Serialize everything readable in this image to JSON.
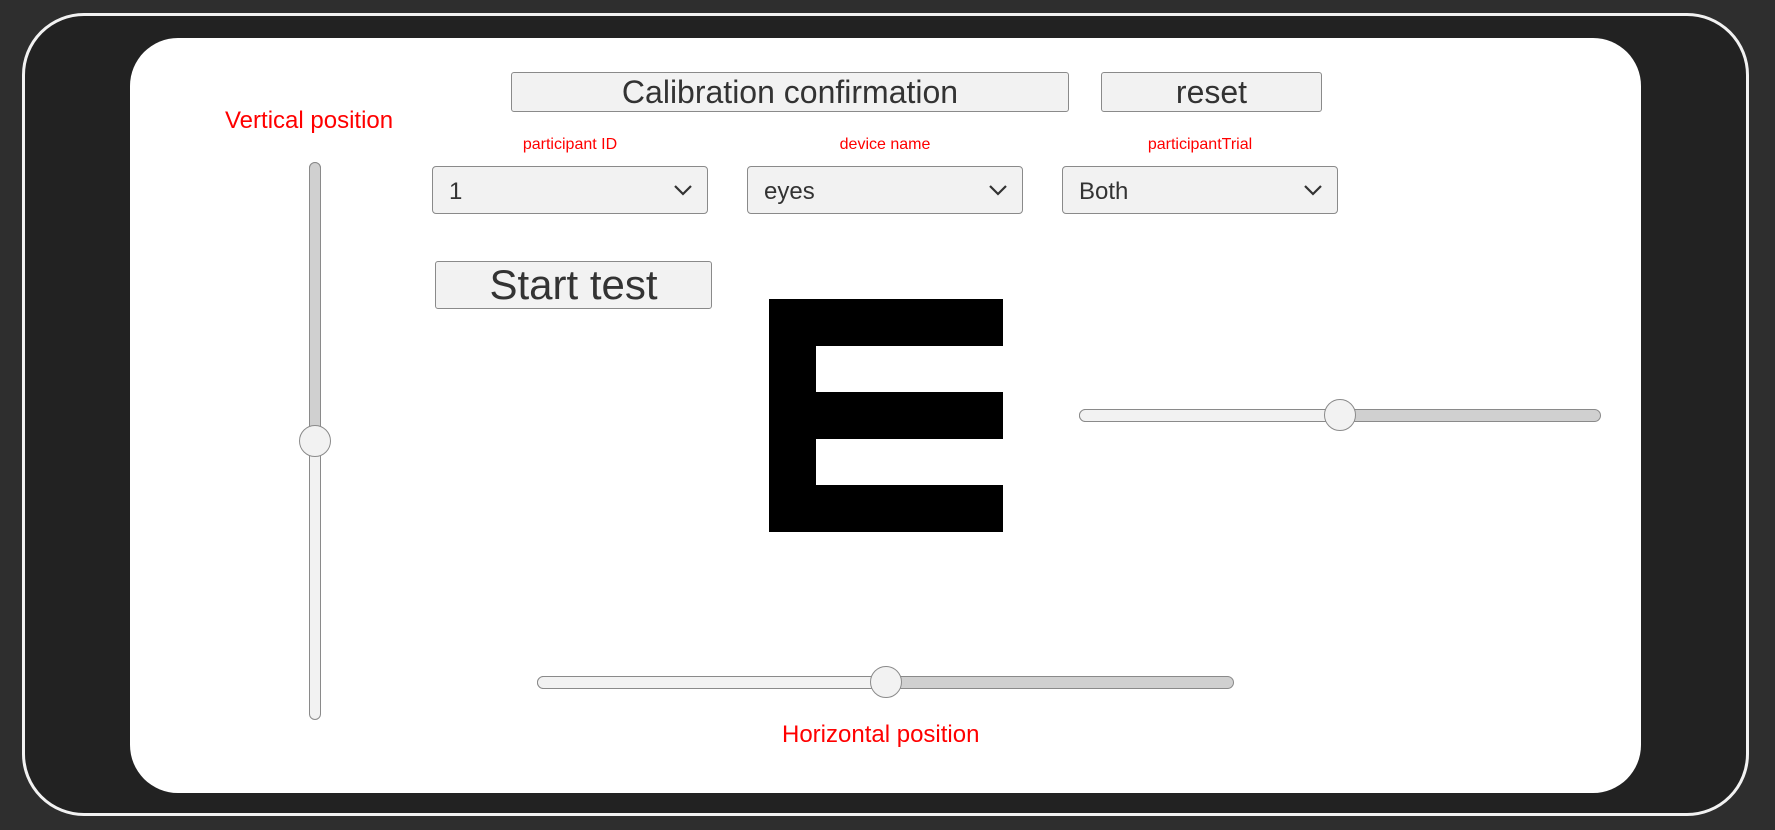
{
  "header": {
    "calibration_button": "Calibration confirmation",
    "reset_button": "reset"
  },
  "labels": {
    "vertical_position": "Vertical position",
    "horizontal_position": "Horizontal position"
  },
  "dropdowns": {
    "participant_id": {
      "label": "participant ID",
      "value": "1"
    },
    "device_name": {
      "label": "device name",
      "value": "eyes"
    },
    "participant_trial": {
      "label": "participantTrial",
      "value": "Both"
    }
  },
  "start_button": "Start test",
  "optotype": {
    "letter": "E"
  },
  "sliders": {
    "vertical_level": 0.5,
    "horizontal_level": 0.5,
    "size_level": 0.5
  },
  "colors": {
    "label_red": "#ff0000",
    "control_fill": "#f2f2f2",
    "track_filled": "#d0d0d0",
    "border": "#8a8a8a"
  }
}
